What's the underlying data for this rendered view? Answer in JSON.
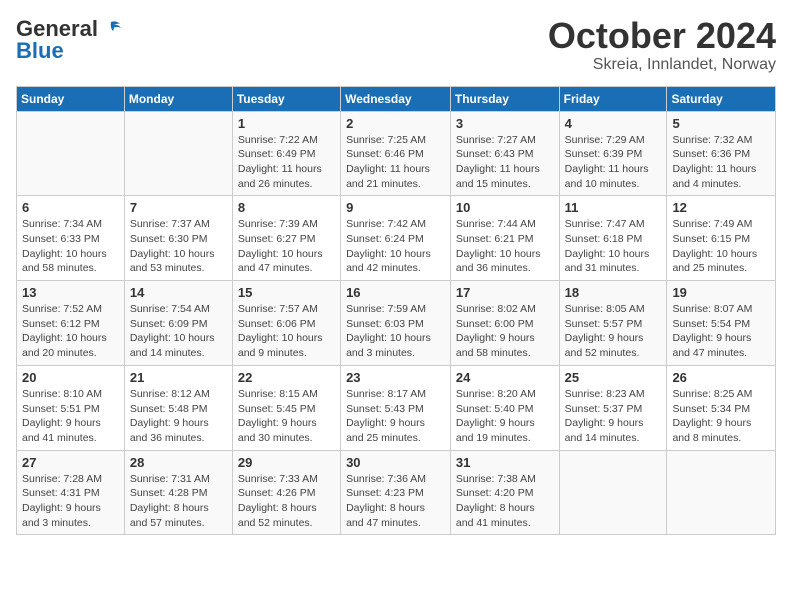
{
  "header": {
    "logo_general": "General",
    "logo_blue": "Blue",
    "month": "October 2024",
    "location": "Skreia, Innlandet, Norway"
  },
  "weekdays": [
    "Sunday",
    "Monday",
    "Tuesday",
    "Wednesday",
    "Thursday",
    "Friday",
    "Saturday"
  ],
  "weeks": [
    [
      {
        "day": "",
        "info": ""
      },
      {
        "day": "",
        "info": ""
      },
      {
        "day": "1",
        "info": "Sunrise: 7:22 AM\nSunset: 6:49 PM\nDaylight: 11 hours and 26 minutes."
      },
      {
        "day": "2",
        "info": "Sunrise: 7:25 AM\nSunset: 6:46 PM\nDaylight: 11 hours and 21 minutes."
      },
      {
        "day": "3",
        "info": "Sunrise: 7:27 AM\nSunset: 6:43 PM\nDaylight: 11 hours and 15 minutes."
      },
      {
        "day": "4",
        "info": "Sunrise: 7:29 AM\nSunset: 6:39 PM\nDaylight: 11 hours and 10 minutes."
      },
      {
        "day": "5",
        "info": "Sunrise: 7:32 AM\nSunset: 6:36 PM\nDaylight: 11 hours and 4 minutes."
      }
    ],
    [
      {
        "day": "6",
        "info": "Sunrise: 7:34 AM\nSunset: 6:33 PM\nDaylight: 10 hours and 58 minutes."
      },
      {
        "day": "7",
        "info": "Sunrise: 7:37 AM\nSunset: 6:30 PM\nDaylight: 10 hours and 53 minutes."
      },
      {
        "day": "8",
        "info": "Sunrise: 7:39 AM\nSunset: 6:27 PM\nDaylight: 10 hours and 47 minutes."
      },
      {
        "day": "9",
        "info": "Sunrise: 7:42 AM\nSunset: 6:24 PM\nDaylight: 10 hours and 42 minutes."
      },
      {
        "day": "10",
        "info": "Sunrise: 7:44 AM\nSunset: 6:21 PM\nDaylight: 10 hours and 36 minutes."
      },
      {
        "day": "11",
        "info": "Sunrise: 7:47 AM\nSunset: 6:18 PM\nDaylight: 10 hours and 31 minutes."
      },
      {
        "day": "12",
        "info": "Sunrise: 7:49 AM\nSunset: 6:15 PM\nDaylight: 10 hours and 25 minutes."
      }
    ],
    [
      {
        "day": "13",
        "info": "Sunrise: 7:52 AM\nSunset: 6:12 PM\nDaylight: 10 hours and 20 minutes."
      },
      {
        "day": "14",
        "info": "Sunrise: 7:54 AM\nSunset: 6:09 PM\nDaylight: 10 hours and 14 minutes."
      },
      {
        "day": "15",
        "info": "Sunrise: 7:57 AM\nSunset: 6:06 PM\nDaylight: 10 hours and 9 minutes."
      },
      {
        "day": "16",
        "info": "Sunrise: 7:59 AM\nSunset: 6:03 PM\nDaylight: 10 hours and 3 minutes."
      },
      {
        "day": "17",
        "info": "Sunrise: 8:02 AM\nSunset: 6:00 PM\nDaylight: 9 hours and 58 minutes."
      },
      {
        "day": "18",
        "info": "Sunrise: 8:05 AM\nSunset: 5:57 PM\nDaylight: 9 hours and 52 minutes."
      },
      {
        "day": "19",
        "info": "Sunrise: 8:07 AM\nSunset: 5:54 PM\nDaylight: 9 hours and 47 minutes."
      }
    ],
    [
      {
        "day": "20",
        "info": "Sunrise: 8:10 AM\nSunset: 5:51 PM\nDaylight: 9 hours and 41 minutes."
      },
      {
        "day": "21",
        "info": "Sunrise: 8:12 AM\nSunset: 5:48 PM\nDaylight: 9 hours and 36 minutes."
      },
      {
        "day": "22",
        "info": "Sunrise: 8:15 AM\nSunset: 5:45 PM\nDaylight: 9 hours and 30 minutes."
      },
      {
        "day": "23",
        "info": "Sunrise: 8:17 AM\nSunset: 5:43 PM\nDaylight: 9 hours and 25 minutes."
      },
      {
        "day": "24",
        "info": "Sunrise: 8:20 AM\nSunset: 5:40 PM\nDaylight: 9 hours and 19 minutes."
      },
      {
        "day": "25",
        "info": "Sunrise: 8:23 AM\nSunset: 5:37 PM\nDaylight: 9 hours and 14 minutes."
      },
      {
        "day": "26",
        "info": "Sunrise: 8:25 AM\nSunset: 5:34 PM\nDaylight: 9 hours and 8 minutes."
      }
    ],
    [
      {
        "day": "27",
        "info": "Sunrise: 7:28 AM\nSunset: 4:31 PM\nDaylight: 9 hours and 3 minutes."
      },
      {
        "day": "28",
        "info": "Sunrise: 7:31 AM\nSunset: 4:28 PM\nDaylight: 8 hours and 57 minutes."
      },
      {
        "day": "29",
        "info": "Sunrise: 7:33 AM\nSunset: 4:26 PM\nDaylight: 8 hours and 52 minutes."
      },
      {
        "day": "30",
        "info": "Sunrise: 7:36 AM\nSunset: 4:23 PM\nDaylight: 8 hours and 47 minutes."
      },
      {
        "day": "31",
        "info": "Sunrise: 7:38 AM\nSunset: 4:20 PM\nDaylight: 8 hours and 41 minutes."
      },
      {
        "day": "",
        "info": ""
      },
      {
        "day": "",
        "info": ""
      }
    ]
  ]
}
